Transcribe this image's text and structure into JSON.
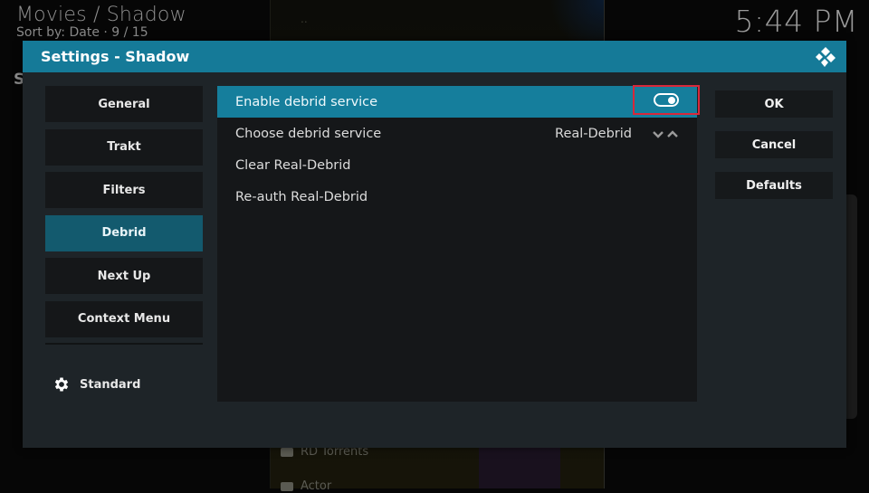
{
  "background": {
    "header_title": "Movies / Shadow",
    "header_subtitle": "Sort by: Date  ·  9 / 15",
    "clock": "5:44 PM",
    "left_letter": "S",
    "list_top_item": "..",
    "list_items": [
      {
        "icon": "folder-icon",
        "label": "RD Torrents"
      },
      {
        "icon": "folder-icon",
        "label": "Actor"
      }
    ]
  },
  "dialog": {
    "title": "Settings - Shadow",
    "logo": "kodi-logo-icon",
    "accent_color": "#157a98",
    "categories": [
      {
        "label": "General",
        "active": false
      },
      {
        "label": "Trakt",
        "active": false
      },
      {
        "label": "Filters",
        "active": false
      },
      {
        "label": "Debrid",
        "active": true
      },
      {
        "label": "Next Up",
        "active": false
      },
      {
        "label": "Context Menu",
        "active": false
      }
    ],
    "settings_level": {
      "icon": "gear-icon",
      "label": "Standard"
    },
    "settings": [
      {
        "label": "Enable debrid service",
        "type": "toggle",
        "value": true,
        "focused": true,
        "highlighted_outline_color": "#d8283a"
      },
      {
        "label": "Choose debrid service",
        "type": "spinner",
        "value": "Real-Debrid",
        "focused": false
      },
      {
        "label": "Clear Real-Debrid",
        "type": "action",
        "focused": false
      },
      {
        "label": "Re-auth Real-Debrid",
        "type": "action",
        "focused": false
      }
    ],
    "buttons": {
      "ok": "OK",
      "cancel": "Cancel",
      "defaults": "Defaults"
    }
  }
}
